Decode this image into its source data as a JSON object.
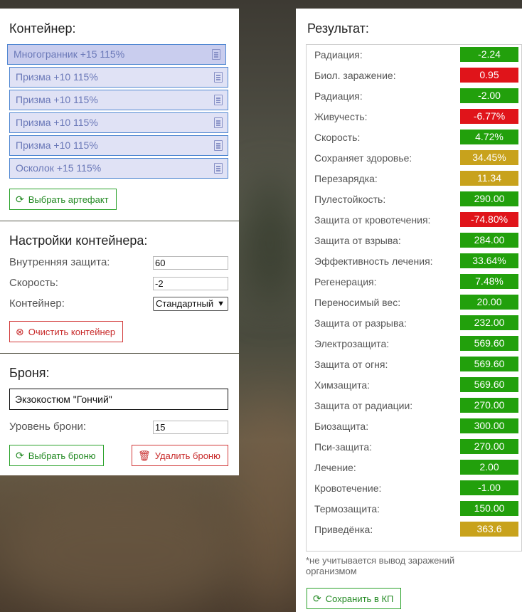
{
  "container": {
    "title": "Контейнер:",
    "artifacts": [
      {
        "label": "Многогранник +15 115%",
        "selected": true
      },
      {
        "label": "Призма +10 115%",
        "selected": false
      },
      {
        "label": "Призма +10 115%",
        "selected": false
      },
      {
        "label": "Призма +10 115%",
        "selected": false
      },
      {
        "label": "Призма +10 115%",
        "selected": false
      },
      {
        "label": "Осколок +15 115%",
        "selected": false
      }
    ],
    "select_artifact_label": "Выбрать артефакт"
  },
  "container_settings": {
    "title": "Настройки контейнера:",
    "inner_protection_label": "Внутренняя защита:",
    "inner_protection_value": "60",
    "speed_label": "Скорость:",
    "speed_value": "-2",
    "container_label": "Контейнер:",
    "container_value": "Стандартный",
    "clear_label": "Очистить контейнер"
  },
  "armor": {
    "title": "Броня:",
    "name": "Экзокостюм \"Гончий\"",
    "level_label": "Уровень брони:",
    "level_value": "15",
    "select_label": "Выбрать броню",
    "delete_label": "Удалить броню"
  },
  "result": {
    "title": "Результат:",
    "rows": [
      {
        "name": "Радиация:",
        "value": "-2.24",
        "color": "#22a00c"
      },
      {
        "name": "Биол. заражение:",
        "value": "0.95",
        "color": "#e0141a"
      },
      {
        "name": "Радиация:",
        "value": "-2.00",
        "color": "#22a00c"
      },
      {
        "name": "Живучесть:",
        "value": "-6.77%",
        "color": "#e0141a"
      },
      {
        "name": "Скорость:",
        "value": "4.72%",
        "color": "#22a00c"
      },
      {
        "name": "Сохраняет здоровье:",
        "value": "34.45%",
        "color": "#c8a21c"
      },
      {
        "name": "Перезарядка:",
        "value": "11.34",
        "color": "#c8a21c"
      },
      {
        "name": "Пулестойкость:",
        "value": "290.00",
        "color": "#22a00c"
      },
      {
        "name": "Защита от кровотечения:",
        "value": "-74.80%",
        "color": "#e0141a"
      },
      {
        "name": "Защита от взрыва:",
        "value": "284.00",
        "color": "#22a00c"
      },
      {
        "name": "Эффективность лечения:",
        "value": "33.64%",
        "color": "#22a00c"
      },
      {
        "name": "Регенерация:",
        "value": "7.48%",
        "color": "#22a00c"
      },
      {
        "name": "Переносимый вес:",
        "value": "20.00",
        "color": "#22a00c"
      },
      {
        "name": "Защита от разрыва:",
        "value": "232.00",
        "color": "#22a00c"
      },
      {
        "name": "Электрозащита:",
        "value": "569.60",
        "color": "#22a00c"
      },
      {
        "name": "Защита от огня:",
        "value": "569.60",
        "color": "#22a00c"
      },
      {
        "name": "Химзащита:",
        "value": "569.60",
        "color": "#22a00c"
      },
      {
        "name": "Защита от радиации:",
        "value": "270.00",
        "color": "#22a00c"
      },
      {
        "name": "Биозащита:",
        "value": "300.00",
        "color": "#22a00c"
      },
      {
        "name": "Пси-защита:",
        "value": "270.00",
        "color": "#22a00c"
      },
      {
        "name": "Лечение:",
        "value": "2.00",
        "color": "#22a00c"
      },
      {
        "name": "Кровотечение:",
        "value": "-1.00",
        "color": "#22a00c"
      },
      {
        "name": "Термозащита:",
        "value": "150.00",
        "color": "#22a00c"
      },
      {
        "name": "Приведёнка:",
        "value": "363.6",
        "color": "#c8a21c"
      }
    ],
    "note": "*не учитывается вывод заражений организмом",
    "save_label": "Сохранить в КП"
  }
}
